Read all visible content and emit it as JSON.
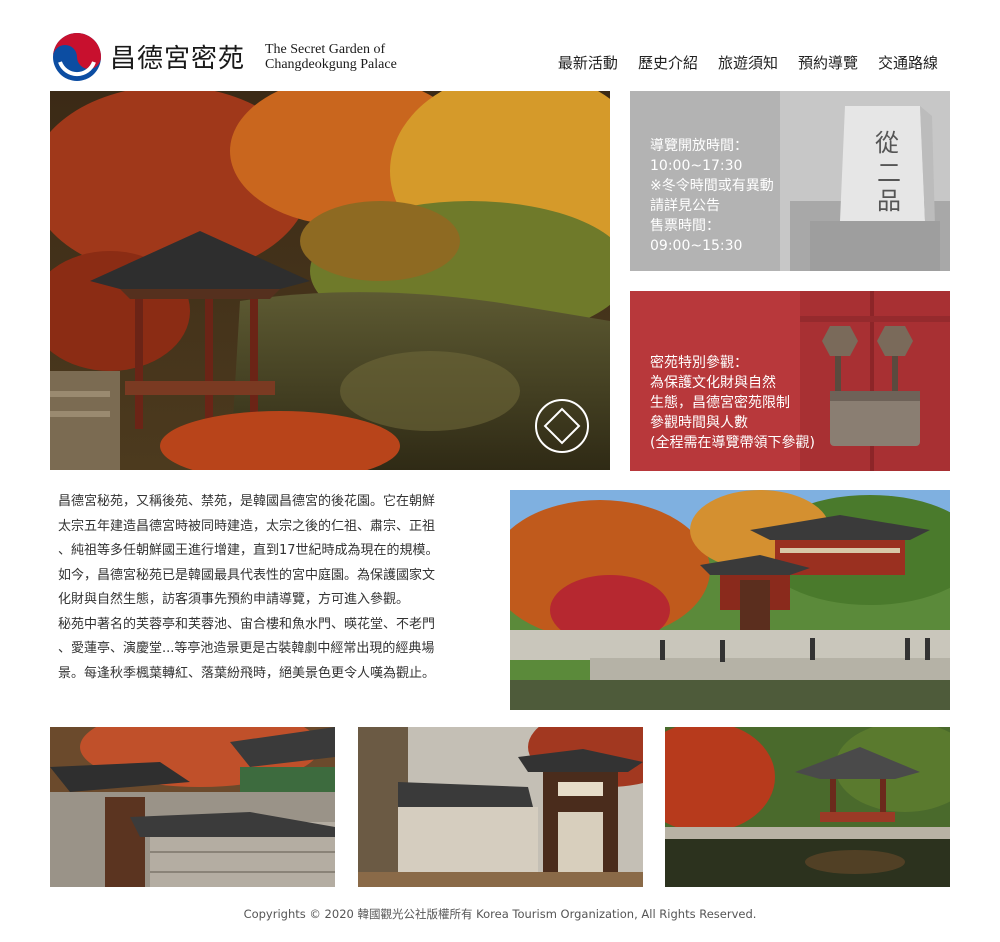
{
  "brand": {
    "name_cn": "昌德宮密苑",
    "name_en_line1": "The Secret Garden of",
    "name_en_line2": "Changdeokgung Palace"
  },
  "nav": {
    "items": [
      "最新活動",
      "歷史介紹",
      "旅遊須知",
      "預約導覽",
      "交通路線"
    ]
  },
  "info_hours": {
    "lines": [
      "導覽開放時間：",
      "10:00~17:30",
      "※冬令時間或有異動",
      "請詳見公告",
      "售票時間：",
      "09:00~15:30"
    ]
  },
  "info_special": {
    "lines": [
      "密苑特別參觀：",
      "為保護文化財與自然",
      "生態，昌德宮密苑限制",
      "參觀時間與人數",
      "(全程需在導覽帶領下參觀)"
    ]
  },
  "intro": {
    "lines": [
      "昌德宮秘苑，又稱後苑、禁苑，是韓國昌德宮的後花園。它在朝鮮",
      "太宗五年建造昌德宮時被同時建造，太宗之後的仁祖、肅宗、正祖",
      "、純祖等多任朝鮮國王進行增建，直到17世紀時成為現在的規模。",
      "如今，昌德宮秘苑已是韓國最具代表性的宮中庭園。為保護國家文",
      "化財與自然生態，訪客須事先預約申請導覽，方可進入參觀。",
      "秘苑中著名的芙蓉亭和芙蓉池、宙合樓和魚水門、暎花堂、不老門",
      "、愛蓮亭、演慶堂...等亭池造景更是古裝韓劇中經常出現的經典場",
      "景。每逢秋季楓葉轉紅、落葉紛飛時，絕美景色更令人嘆為觀止。"
    ]
  },
  "footer": {
    "copyright": "Copyrights © 2020 韓國觀光公社版權所有 Korea Tourism Organization, All Rights Reserved."
  },
  "colors": {
    "red_panel": "#b8383b",
    "grey_panel": "#b3b3b3",
    "logo_red": "#c8102e",
    "logo_blue": "#0c4da2"
  },
  "icons": {
    "logo": "taegeuk-logo-icon",
    "unesco": "world-heritage-emblem-icon"
  }
}
